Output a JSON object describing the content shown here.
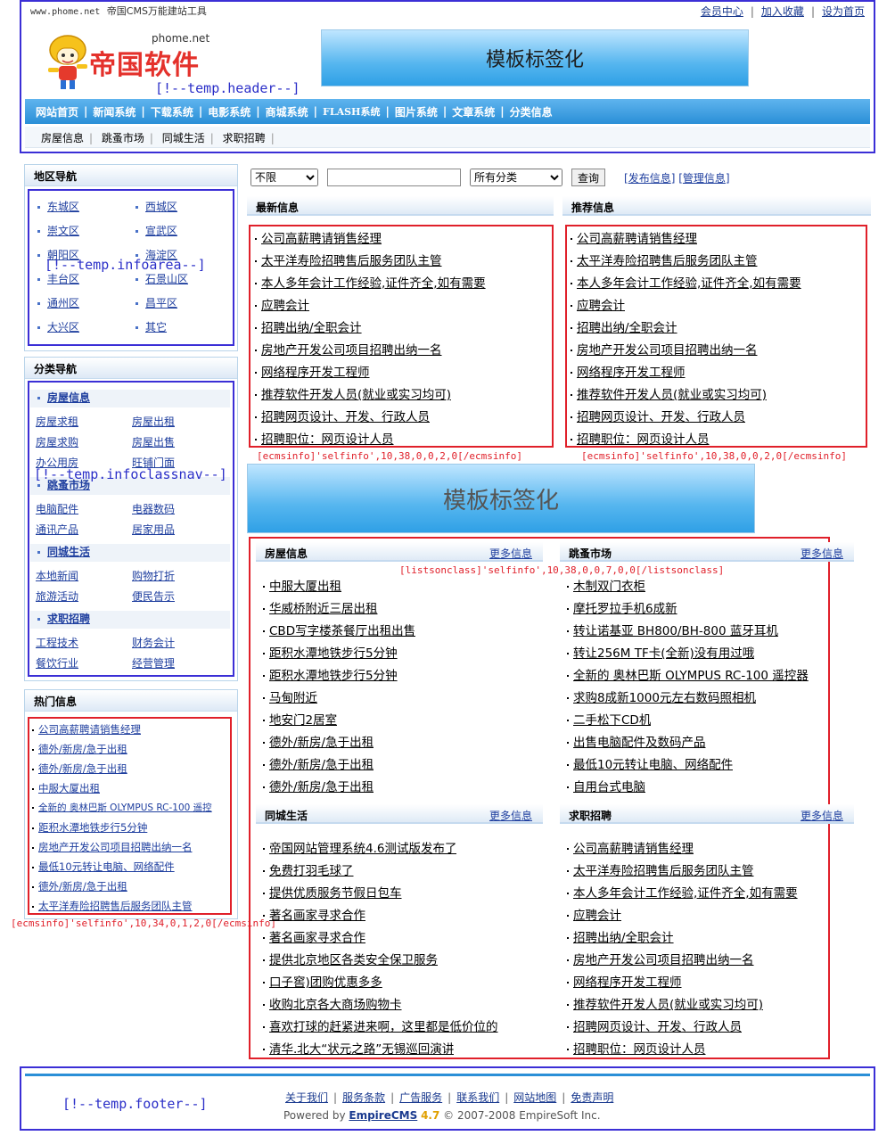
{
  "header": {
    "site_small": "www.phome.net",
    "site_title": "帝国CMS万能建站工具",
    "top_links": [
      "会员中心",
      "加入收藏",
      "设为首页"
    ],
    "logo_url_text": "phome.net",
    "logo_text": "帝国软件",
    "temp_tag": "[!--temp.header--]",
    "banner_text": "模板标签化",
    "nav": [
      "网站首页",
      "新闻系统",
      "下载系统",
      "电影系统",
      "商城系统",
      "FLASH系统",
      "图片系统",
      "文章系统",
      "分类信息"
    ],
    "subnav": [
      "房屋信息",
      "跳蚤市场",
      "同城生活",
      "求职招聘"
    ]
  },
  "region": {
    "title": "地区导航",
    "items": [
      "东城区",
      "西城区",
      "崇文区",
      "宣武区",
      "朝阳区",
      "海淀区",
      "丰台区",
      "石景山区",
      "通州区",
      "昌平区",
      "大兴区",
      "其它"
    ],
    "temp_tag": "[!--temp.infoarea--]"
  },
  "classnav": {
    "title": "分类导航",
    "temp_tag": "[!--temp.infoclassnav--]",
    "groups": [
      {
        "name": "房屋信息",
        "items": [
          "房屋求租",
          "房屋出租",
          "房屋求购",
          "房屋出售",
          "办公用房",
          "旺铺门面"
        ]
      },
      {
        "name": "跳蚤市场",
        "items": [
          "电脑配件",
          "电器数码",
          "通讯产品",
          "居家用品"
        ]
      },
      {
        "name": "同城生活",
        "items": [
          "本地新闻",
          "购物打折",
          "旅游活动",
          "便民告示"
        ]
      },
      {
        "name": "求职招聘",
        "items": [
          "工程技术",
          "财务会计",
          "餐饮行业",
          "经营管理"
        ]
      }
    ]
  },
  "hot": {
    "title": "热门信息",
    "items": [
      "公司高薪聘请销售经理",
      "德外/新房/急于出租",
      "德外/新房/急于出租",
      "中服大厦出租",
      "全新的 奥林巴斯 OLYMPUS RC-100 遥控",
      "距积水潭地铁步行5分钟",
      "房地产开发公司项目招聘出纳一名",
      "最低10元转让电脑、网络配件",
      "德外/新房/急于出租",
      "太平洋寿险招聘售后服务团队主管"
    ],
    "tag": "[ecmsinfo]'selfinfo',10,34,0,1,2,0[/ecmsinfo]"
  },
  "search": {
    "range": "不限",
    "query": "",
    "category": "所有分类",
    "button": "查询",
    "links": [
      "发布信息",
      "管理信息"
    ]
  },
  "latest": {
    "title": "最新信息",
    "items": [
      "公司高薪聘请销售经理",
      "太平洋寿险招聘售后服务团队主管",
      "本人多年会计工作经验,证件齐全,如有需要",
      "应聘会计",
      "招聘出纳/全职会计",
      "房地产开发公司项目招聘出纳一名",
      "网络程序开发工程师",
      "推荐软件开发人员(就业或实习均可)",
      "招聘网页设计、开发、行政人员",
      "招聘职位：网页设计人员"
    ],
    "tag": "[ecmsinfo]'selfinfo',10,38,0,0,2,0[/ecmsinfo]"
  },
  "recommend": {
    "title": "推荐信息",
    "items": [
      "公司高薪聘请销售经理",
      "太平洋寿险招聘售后服务团队主管",
      "本人多年会计工作经验,证件齐全,如有需要",
      "应聘会计",
      "招聘出纳/全职会计",
      "房地产开发公司项目招聘出纳一名",
      "网络程序开发工程师",
      "推荐软件开发人员(就业或实习均可)",
      "招聘网页设计、开发、行政人员",
      "招聘职位：网页设计人员"
    ],
    "tag": "[ecmsinfo]'selfinfo',10,38,0,0,2,0[/ecmsinfo]"
  },
  "mid_banner": "模板标签化",
  "list_tag": "[listsonclass]'selfinfo',10,38,0,0,7,0,0[/listsonclass]",
  "more_label": "更多信息",
  "sections": [
    {
      "title": "房屋信息",
      "items": [
        "中服大厦出租",
        "华威桥附近三居出租",
        "CBD写字楼茶餐厅出租出售",
        "距积水潭地铁步行5分钟",
        "距积水潭地铁步行5分钟",
        "马甸附近",
        "地安门2居室",
        "德外/新房/急于出租",
        "德外/新房/急于出租",
        "德外/新房/急于出租"
      ]
    },
    {
      "title": "跳蚤市场",
      "items": [
        "木制双门衣柜",
        "摩托罗拉手机6成新",
        "转让诺基亚 BH800/BH-800 蓝牙耳机",
        "转让256M TF卡(全新)没有用过哦",
        "全新的 奥林巴斯 OLYMPUS RC-100 遥控器",
        "求购8成新1000元左右数码照相机",
        "二手松下CD机",
        "出售电脑配件及数码产品",
        "最低10元转让电脑、网络配件",
        "自用台式电脑"
      ]
    },
    {
      "title": "同城生活",
      "items": [
        "帝国网站管理系统4.6测试版发布了",
        "免费打羽毛球了",
        "提供优质服务节假日包车",
        "著名画家寻求合作",
        "著名画家寻求合作",
        "提供北京地区各类安全保卫服务",
        "口子窖)团购优惠多多",
        "收购北京各大商场购物卡",
        "喜欢打球的赶紧进来啊，这里都是低价位的",
        "清华.北大“状元之路”无锡巡回演讲"
      ]
    },
    {
      "title": "求职招聘",
      "items": [
        "公司高薪聘请销售经理",
        "太平洋寿险招聘售后服务团队主管",
        "本人多年会计工作经验,证件齐全,如有需要",
        "应聘会计",
        "招聘出纳/全职会计",
        "房地产开发公司项目招聘出纳一名",
        "网络程序开发工程师",
        "推荐软件开发人员(就业或实习均可)",
        "招聘网页设计、开发、行政人员",
        "招聘职位：网页设计人员"
      ]
    }
  ],
  "footer": {
    "temp_tag": "[!--temp.footer--]",
    "links": [
      "关于我们",
      "服务条款",
      "广告服务",
      "联系我们",
      "网站地图",
      "免责声明"
    ],
    "powered_prefix": "Powered by",
    "product": "EmpireCMS",
    "version": "4.7",
    "copyright": "© 2007-2008 EmpireSoft Inc."
  }
}
